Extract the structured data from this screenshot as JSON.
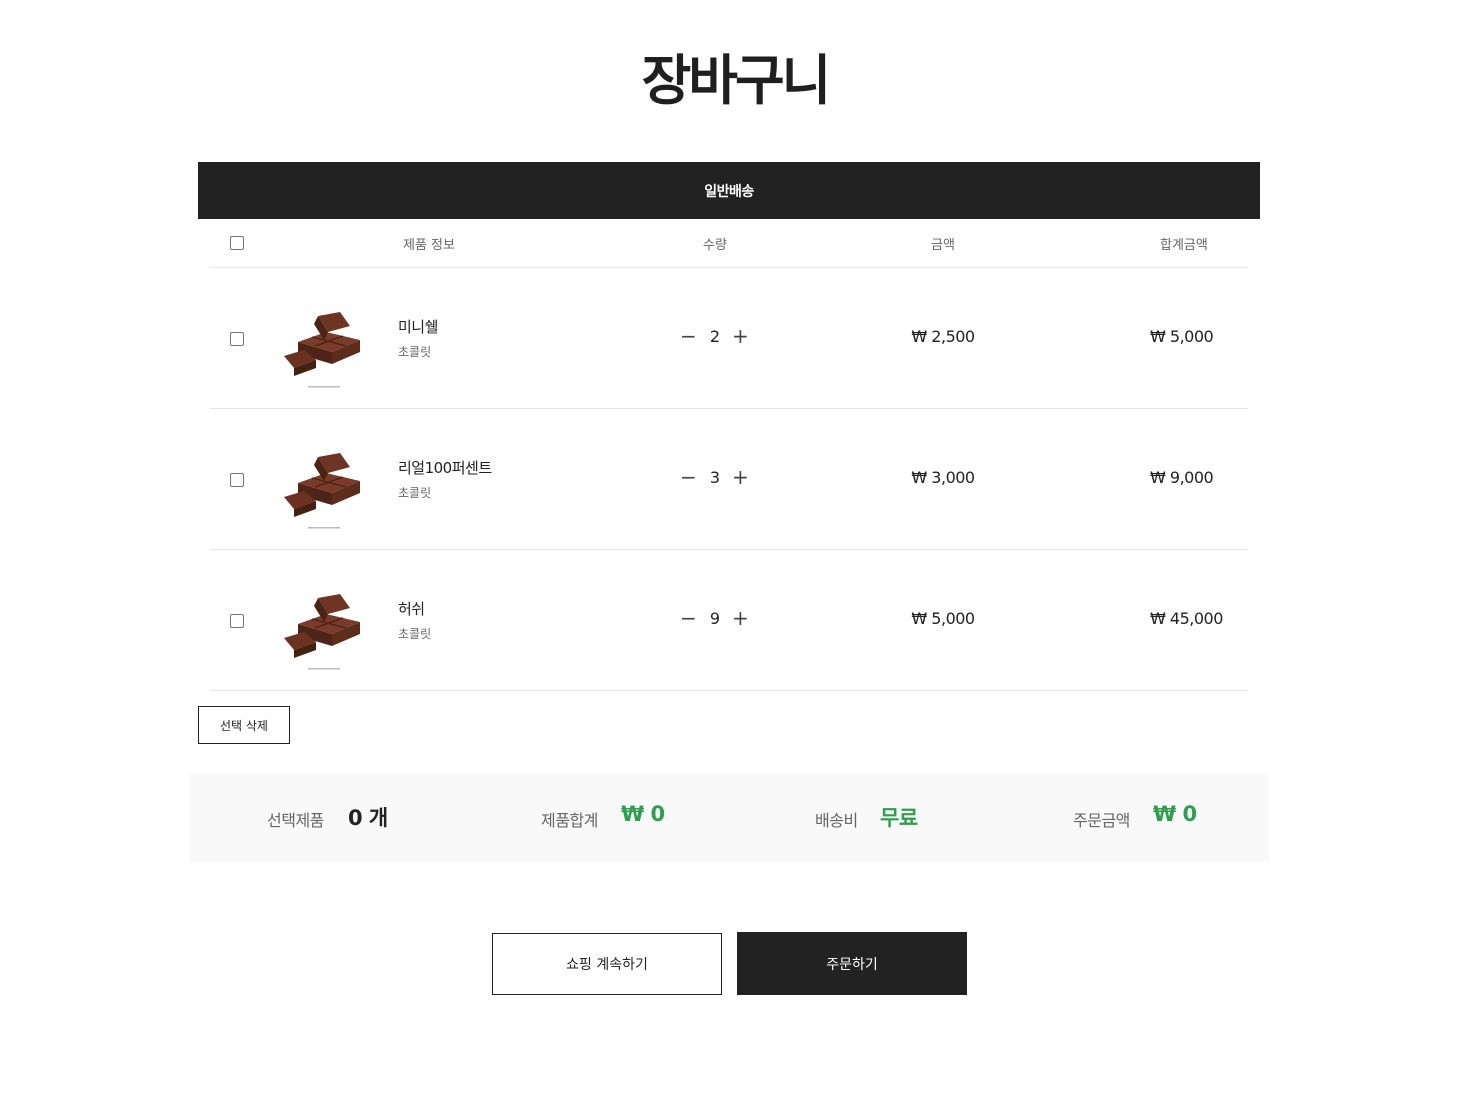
{
  "page": {
    "title": "장바구니"
  },
  "shipping": {
    "label": "일반배송"
  },
  "table_headers": {
    "product_info": "제품 정보",
    "quantity": "수량",
    "price": "금액",
    "total": "합계금액"
  },
  "items": [
    {
      "name": "미니쉘",
      "category": "초콜릿",
      "quantity": "2",
      "price": "₩ 2,500",
      "total": "₩ 5,000"
    },
    {
      "name": "리얼100퍼센트",
      "category": "초콜릿",
      "quantity": "3",
      "price": "₩ 3,000",
      "total": "₩ 9,000"
    },
    {
      "name": "허쉬",
      "category": "초콜릿",
      "quantity": "9",
      "price": "₩ 5,000",
      "total": "₩ 45,000"
    }
  ],
  "controls": {
    "minus_glyph": "−",
    "plus_glyph": "+",
    "delete_selected": "선택 삭제"
  },
  "summary": {
    "selected_label": "선택제품",
    "selected_value": "0 개",
    "subtotal_label": "제품합계",
    "subtotal_value": "₩ 0",
    "shipping_label": "배송비",
    "shipping_value": "무료",
    "order_label": "주문금액",
    "order_value": "₩ 0"
  },
  "buttons": {
    "continue_shopping": "쇼핑 계속하기",
    "order": "주문하기"
  },
  "colors": {
    "accent_green": "#2e9e4f",
    "dark": "#222222"
  },
  "icons": {
    "product_thumb": "chocolate-image-icon"
  }
}
